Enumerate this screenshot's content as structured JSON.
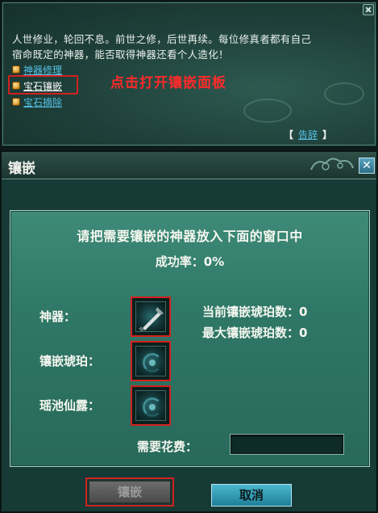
{
  "npc_dialog": {
    "text_line1": "人世修业，轮回不息。前世之修，后世再续。每位修真者都有自己",
    "text_line2": "宿命既定的神器，能否取得神器还看个人造化！",
    "options": [
      {
        "label": "神器修理"
      },
      {
        "label": "宝石镶嵌"
      },
      {
        "label": "宝石摘除"
      }
    ],
    "annotation": "点击打开镶嵌面板",
    "farewell_open": "【",
    "farewell_label": "告辞",
    "farewell_close": "】"
  },
  "inlay_window": {
    "title": "镶嵌",
    "close_glyph": "✕",
    "prompt": "请把需要镶嵌的神器放入下面的窗口中",
    "success_rate": "成功率：0%",
    "slots": [
      {
        "label": "神器：",
        "icon": "artifact-icon"
      },
      {
        "label": "镶嵌琥珀：",
        "icon": "amber-swirl-icon"
      },
      {
        "label": "瑶池仙露：",
        "icon": "dew-swirl-icon"
      }
    ],
    "current_amber": "当前镶嵌琥珀数：0",
    "max_amber": "最大镶嵌琥珀数：0",
    "cost_label": "需要花费：",
    "cost_value": "",
    "buttons": {
      "inlay": "镶嵌",
      "cancel": "取消"
    }
  },
  "colors": {
    "highlight_red": "#d42020",
    "link_blue": "#55c2e6",
    "panel_green": "#2f7766"
  }
}
